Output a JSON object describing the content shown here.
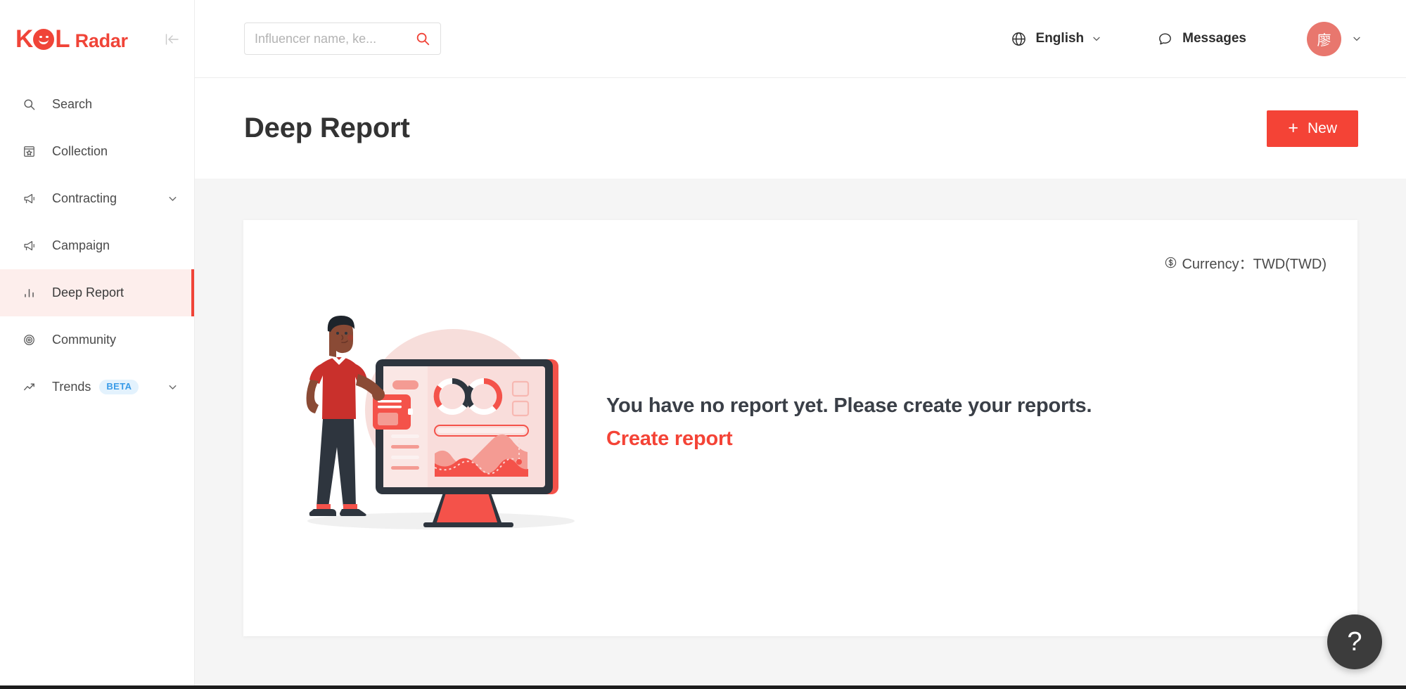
{
  "brand": {
    "name_primary": "KOL",
    "name_secondary": "Radar",
    "accent_color": "#F04438"
  },
  "sidebar": {
    "collapse_icon": "collapse-left-icon",
    "items": [
      {
        "label": "Search",
        "icon": "search-icon",
        "active": false,
        "expandable": false,
        "badge": null
      },
      {
        "label": "Collection",
        "icon": "bookmark-star-icon",
        "active": false,
        "expandable": false,
        "badge": null
      },
      {
        "label": "Contracting",
        "icon": "megaphone-icon",
        "active": false,
        "expandable": true,
        "badge": null
      },
      {
        "label": "Campaign",
        "icon": "megaphone-icon",
        "active": false,
        "expandable": false,
        "badge": null
      },
      {
        "label": "Deep Report",
        "icon": "bar-chart-icon",
        "active": true,
        "expandable": false,
        "badge": null
      },
      {
        "label": "Community",
        "icon": "target-icon",
        "active": false,
        "expandable": false,
        "badge": null
      },
      {
        "label": "Trends",
        "icon": "trend-line-icon",
        "active": false,
        "expandable": true,
        "badge": "BETA"
      }
    ]
  },
  "topbar": {
    "search": {
      "placeholder": "Influencer name, ke...",
      "value": "",
      "icon": "search-icon"
    },
    "language": {
      "label": "English",
      "icon": "globe-icon",
      "chevron": "chevron-down-icon"
    },
    "messages": {
      "label": "Messages",
      "icon": "chat-bubble-icon"
    },
    "account": {
      "avatar_initial": "廖",
      "avatar_color": "#E8776E",
      "chevron": "chevron-down-icon"
    }
  },
  "page": {
    "title": "Deep Report",
    "new_button": {
      "label": "New",
      "plus": "+",
      "color": "#F44336"
    }
  },
  "card": {
    "currency": {
      "icon": "currency-circle-icon",
      "text": "Currency：TWD(TWD)"
    },
    "empty_state": {
      "headline": "You have no report yet. Please create your reports.",
      "action_label": "Create report",
      "action_color": "#F44336",
      "illustration": "analytics-dashboard-person-illustration"
    }
  },
  "help": {
    "label": "?",
    "icon": "question-mark-icon"
  }
}
